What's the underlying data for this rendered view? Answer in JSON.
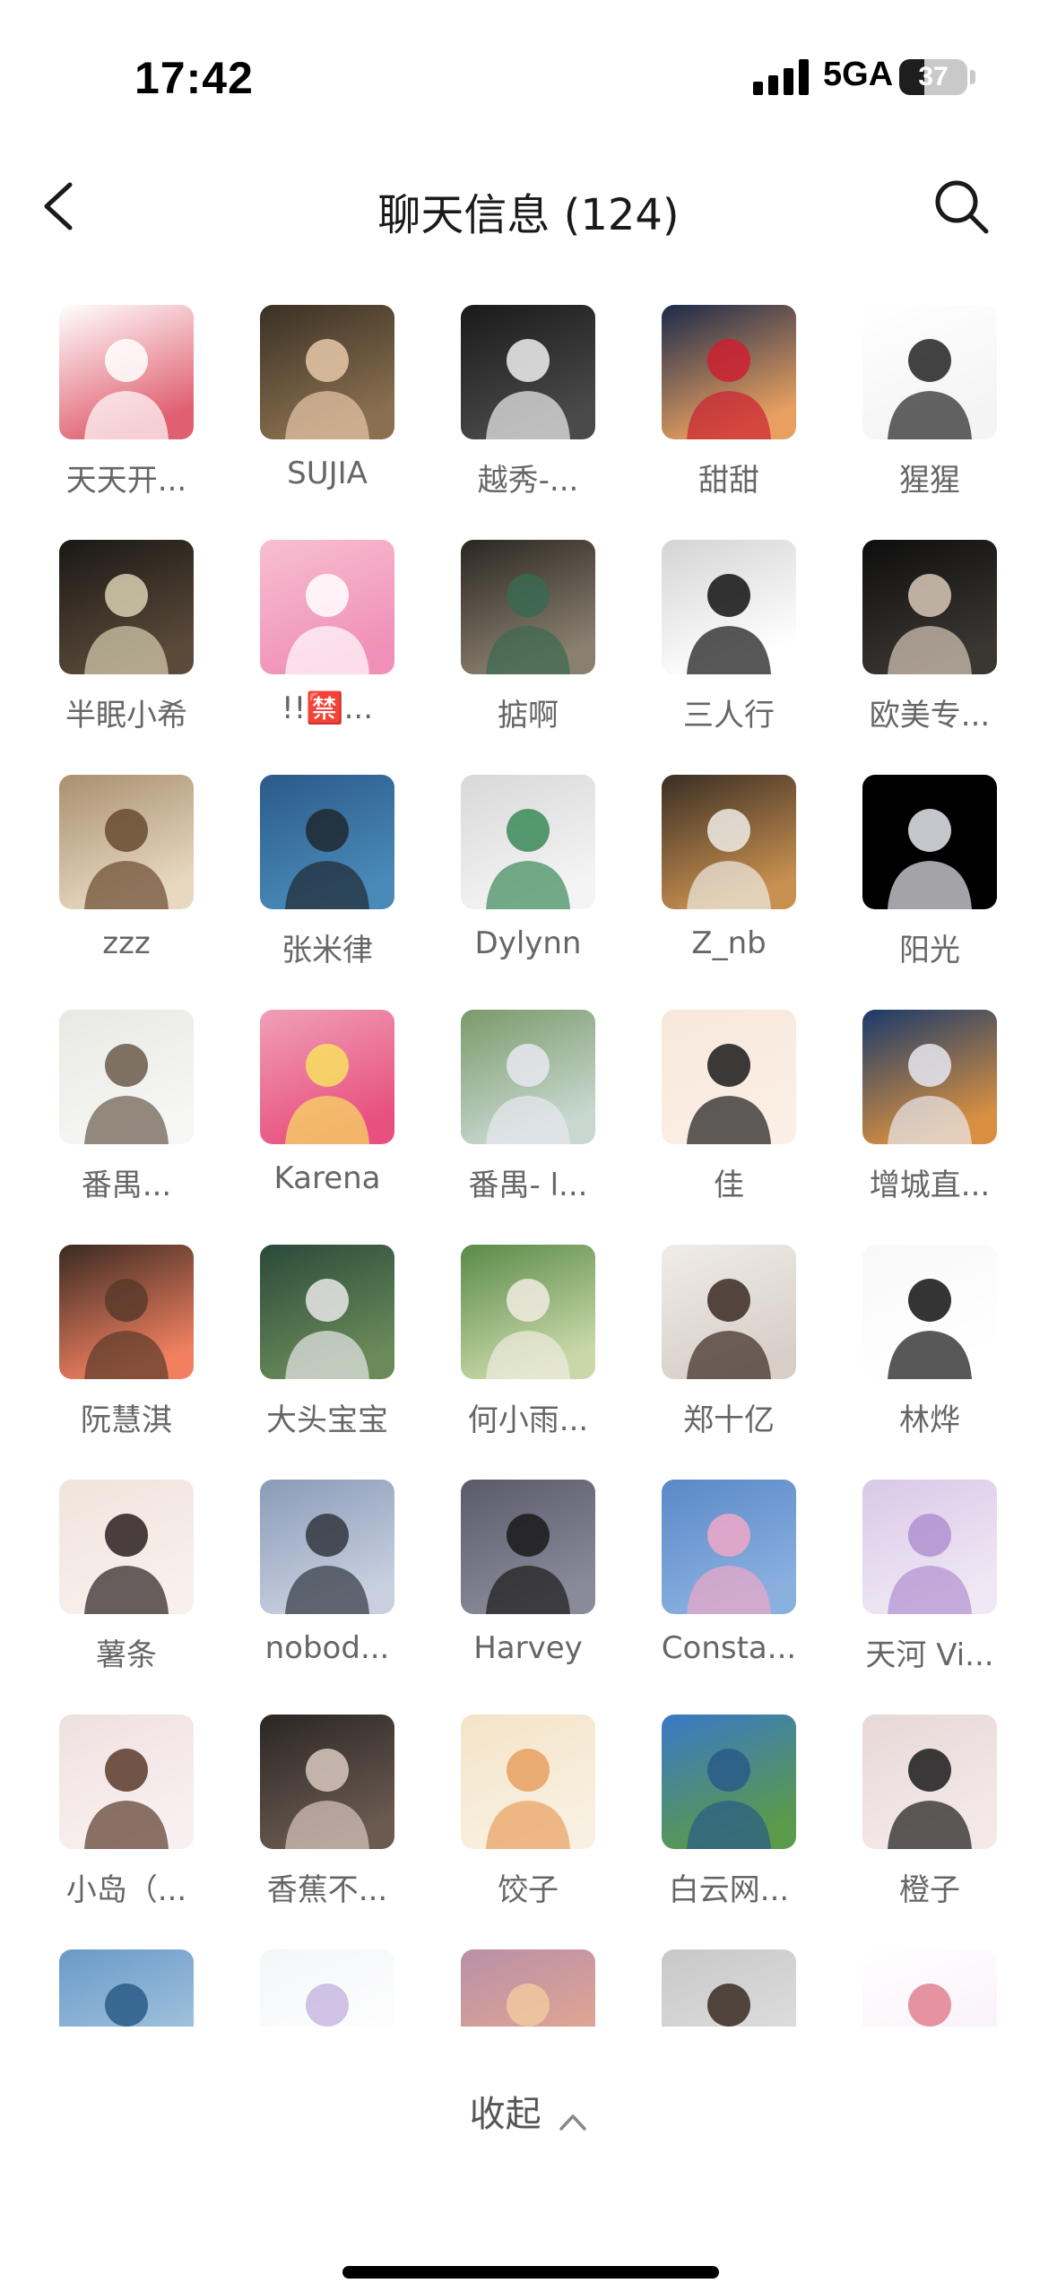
{
  "status_bar": {
    "time": "17:42",
    "network": "5GA",
    "battery_level": "37",
    "battery_fraction": 0.37,
    "signal_bars": 4
  },
  "nav": {
    "title": "聊天信息 (124)",
    "back_icon": "chevron-left-icon",
    "search_icon": "search-icon"
  },
  "members": [
    {
      "name": "天天开...",
      "avatar": "smile-text-avatar",
      "colors": [
        "#ffffff",
        "#e06070",
        "#ffffff"
      ]
    },
    {
      "name": "SUJIA",
      "avatar": "photo-girl-night",
      "colors": [
        "#3a3024",
        "#8a7050",
        "#e8c8a8"
      ]
    },
    {
      "name": "越秀-...",
      "avatar": "photo-boy-white-shirt",
      "colors": [
        "#1a1a1a",
        "#4a4a4a",
        "#f0f0f0"
      ]
    },
    {
      "name": "甜甜",
      "avatar": "photo-girl-city-dusk",
      "colors": [
        "#1c2a4a",
        "#e8a060",
        "#cc2030"
      ]
    },
    {
      "name": "猩猩",
      "avatar": "ink-circle-avatar",
      "colors": [
        "#ffffff",
        "#f4f4f4",
        "#222222"
      ]
    },
    {
      "name": "半眠小希",
      "avatar": "photo-night-street",
      "colors": [
        "#1a1814",
        "#5a4a3a",
        "#d8d0b0"
      ]
    },
    {
      "name": "!!🈲...",
      "avatar": "anime-pink-girl",
      "colors": [
        "#f7c0d0",
        "#f090b8",
        "#ffffff"
      ]
    },
    {
      "name": "掂啊",
      "avatar": "photo-hands-pillow",
      "colors": [
        "#2a2620",
        "#8a8070",
        "#3a6a50"
      ]
    },
    {
      "name": "三人行",
      "avatar": "film-camera-stairs",
      "colors": [
        "#d4d4d4",
        "#ffffff",
        "#111111"
      ]
    },
    {
      "name": "欧美专...",
      "avatar": "photo-girl-dark",
      "colors": [
        "#0e0e0e",
        "#3a3632",
        "#d8c8b8"
      ]
    },
    {
      "name": "zzz",
      "avatar": "photo-child-cap",
      "colors": [
        "#a89070",
        "#e8d8c0",
        "#6a4a30"
      ]
    },
    {
      "name": "张米律",
      "avatar": "photo-boy-sea",
      "colors": [
        "#2a5a8a",
        "#4a8ab8",
        "#202830"
      ]
    },
    {
      "name": "Dylynn",
      "avatar": "cat-face",
      "colors": [
        "#d8d8d8",
        "#f4f4f4",
        "#3a8a5a"
      ]
    },
    {
      "name": "Z_nb",
      "avatar": "photo-room-lamp",
      "colors": [
        "#3a2e24",
        "#c89050",
        "#f0ece6"
      ]
    },
    {
      "name": "阳光",
      "avatar": "figure-on-black",
      "colors": [
        "#000000",
        "#000000",
        "#e8e8f0"
      ]
    },
    {
      "name": "番禺...",
      "avatar": "photo-tattoo-arm",
      "colors": [
        "#e8e8e4",
        "#f6f6f4",
        "#6a5a4a"
      ]
    },
    {
      "name": "Karena",
      "avatar": "anime-sailor-moon",
      "colors": [
        "#f0a0b8",
        "#e85080",
        "#f8e060"
      ]
    },
    {
      "name": "番禺- l...",
      "avatar": "photo-lake-picnic",
      "colors": [
        "#7a9a6a",
        "#c8d8d0",
        "#e8e8f0"
      ]
    },
    {
      "name": "佳",
      "avatar": "illustration-lady",
      "colors": [
        "#f7e8dc",
        "#fbeee4",
        "#1a1a1a"
      ]
    },
    {
      "name": "增城直...",
      "avatar": "photo-snow-mountain",
      "colors": [
        "#1a3a6a",
        "#d89040",
        "#e8e8f0"
      ]
    },
    {
      "name": "阮慧淇",
      "avatar": "photo-dog-costume",
      "colors": [
        "#3a2a22",
        "#f08060",
        "#5a3a2a"
      ]
    },
    {
      "name": "大头宝宝",
      "avatar": "photo-child-standing",
      "colors": [
        "#2a4a3a",
        "#6a8a5a",
        "#e8e8e8"
      ]
    },
    {
      "name": "何小雨...",
      "avatar": "photo-girl-field",
      "colors": [
        "#5a8a4a",
        "#c8d8a8",
        "#f0ece0"
      ]
    },
    {
      "name": "郑十亿",
      "avatar": "photo-girl-glasses",
      "colors": [
        "#f0ece8",
        "#d8d0c8",
        "#3a2a22"
      ]
    },
    {
      "name": "林烨",
      "avatar": "manga-boy",
      "colors": [
        "#f8f8f8",
        "#ffffff",
        "#111111"
      ]
    },
    {
      "name": "薯条",
      "avatar": "photo-girl-closeup",
      "colors": [
        "#f0e4dc",
        "#f8f0ec",
        "#2a2020"
      ]
    },
    {
      "name": "nobod...",
      "avatar": "photo-parking-lot",
      "colors": [
        "#8a9ab8",
        "#c8d0e0",
        "#303840"
      ]
    },
    {
      "name": "Harvey",
      "avatar": "photo-mountain-silhouette",
      "colors": [
        "#5a5a6a",
        "#8a8a9a",
        "#1a1a1a"
      ]
    },
    {
      "name": "Consta...",
      "avatar": "cartoon-pig-blue",
      "colors": [
        "#5a88c8",
        "#8ab0e0",
        "#f0a8c8"
      ]
    },
    {
      "name": "天河 Vi...",
      "avatar": "anime-bow-girl",
      "colors": [
        "#d8c8e8",
        "#f0e8f4",
        "#b090d0"
      ]
    },
    {
      "name": "小岛（...",
      "avatar": "photo-girl-dog",
      "colors": [
        "#f0e0e0",
        "#f8f0f0",
        "#5a3a2a"
      ]
    },
    {
      "name": "香蕉不...",
      "avatar": "photo-group-selfie",
      "colors": [
        "#2a2624",
        "#6a5a50",
        "#d8c8c0"
      ]
    },
    {
      "name": "饺子",
      "avatar": "anime-white-hair",
      "colors": [
        "#f4e4c8",
        "#f8f0e0",
        "#e8a060"
      ]
    },
    {
      "name": "白云网...",
      "avatar": "photo-park-lake",
      "colors": [
        "#3a78c8",
        "#5a9a4a",
        "#2a5a88"
      ]
    },
    {
      "name": "橙子",
      "avatar": "photo-girl-long-hair",
      "colors": [
        "#e8d8d8",
        "#f4e8e8",
        "#1a1a1a"
      ]
    },
    {
      "name": "",
      "avatar": "photo-sky-clouds",
      "colors": [
        "#6a9ac8",
        "#a8c8e0",
        "#2a5a88"
      ]
    },
    {
      "name": "",
      "avatar": "illustration-bird",
      "colors": [
        "#f4f6f8",
        "#ffffff",
        "#c8b8e0"
      ]
    },
    {
      "name": "",
      "avatar": "photo-sunset",
      "colors": [
        "#b890a8",
        "#e8a890",
        "#f0c8a0"
      ]
    },
    {
      "name": "",
      "avatar": "photo-woman-portrait",
      "colors": [
        "#c8c8c8",
        "#e0e0e0",
        "#3a2a22"
      ]
    },
    {
      "name": "",
      "avatar": "doodle-girl",
      "colors": [
        "#ffffff",
        "#f8f0f8",
        "#e08090"
      ]
    }
  ],
  "collapse": {
    "label": "收起",
    "icon": "chevron-up-icon"
  },
  "home_indicator": "home-indicator-bar"
}
